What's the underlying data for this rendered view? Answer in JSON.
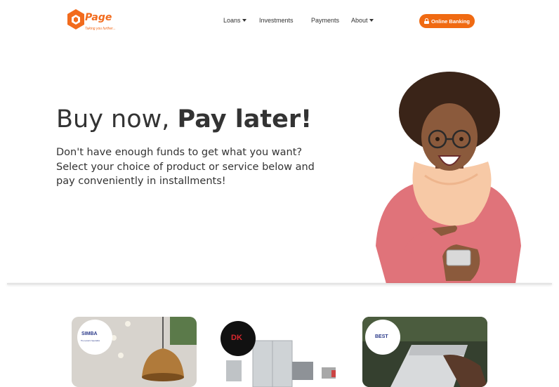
{
  "brand": {
    "name": "Page",
    "tagline": "Taking you further...",
    "color": "#f26b1d"
  },
  "nav": {
    "items": [
      {
        "label": "Loans",
        "has_dropdown": true
      },
      {
        "label": "Investments",
        "has_dropdown": false
      },
      {
        "label": "Payments",
        "has_dropdown": false
      },
      {
        "label": "About",
        "has_dropdown": true
      }
    ],
    "cta": {
      "label": "Online Banking",
      "icon": "lock-icon",
      "color": "#f06a12"
    }
  },
  "hero": {
    "title_regular": "Buy now, ",
    "title_bold": "Pay later!",
    "description": "Don't have enough funds to get what you want? Select your choice of product or service below and pay conveniently in installments!"
  },
  "partners": [
    {
      "badge_text": "SIMBA",
      "badge_sub": "The Lender's Specialists"
    },
    {
      "badge_text": "DK"
    },
    {
      "badge_text": "BEST"
    }
  ]
}
